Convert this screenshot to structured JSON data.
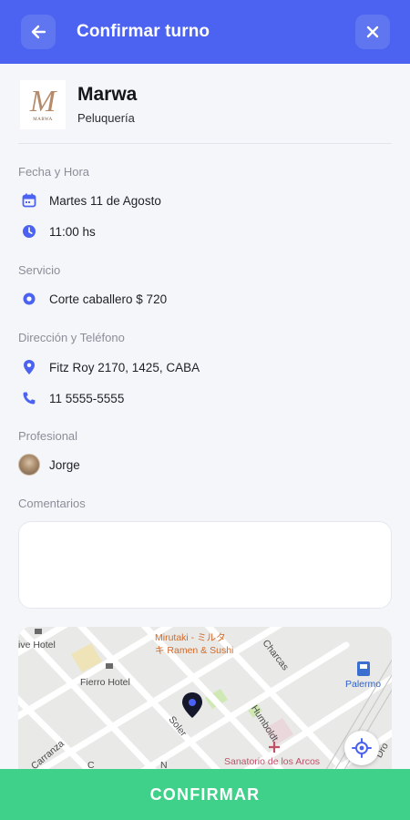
{
  "header": {
    "title": "Confirmar turno",
    "back_icon": "arrow-left-icon",
    "close_icon": "close-icon",
    "color": "#4b63f0"
  },
  "business": {
    "logo_letter": "M",
    "logo_caption": "MARWA",
    "name": "Marwa",
    "category": "Peluquería"
  },
  "date_time": {
    "label": "Fecha y Hora",
    "date": "Martes 11 de Agosto",
    "time": "11:00 hs"
  },
  "service": {
    "label": "Servicio",
    "value": "Corte caballero $ 720"
  },
  "contact": {
    "label": "Dirección y Teléfono",
    "address": "Fitz Roy 2170, 1425, CABA",
    "phone": "11 5555-5555"
  },
  "professional": {
    "label": "Profesional",
    "name": "Jorge"
  },
  "comments": {
    "label": "Comentarios",
    "value": ""
  },
  "map": {
    "labels": {
      "ive_hotel": "ive Hotel",
      "mirutaki_1": "Mirutaki - ミルタ",
      "mirutaki_2": "キ Ramen & Sushi",
      "charcas": "Charcas",
      "fierro_hotel": "Fierro Hotel",
      "palermo": "Palermo",
      "humboldt": "Humboldt",
      "soler": "Soler",
      "sanatorio": "Sanatorio de los Arcos",
      "carranza": "Carranza",
      "c_fragment": "C",
      "n_fragment": "N",
      "dro": "Dro"
    }
  },
  "confirm_button": {
    "label": "CONFIRMAR",
    "color": "#3fd18a"
  }
}
